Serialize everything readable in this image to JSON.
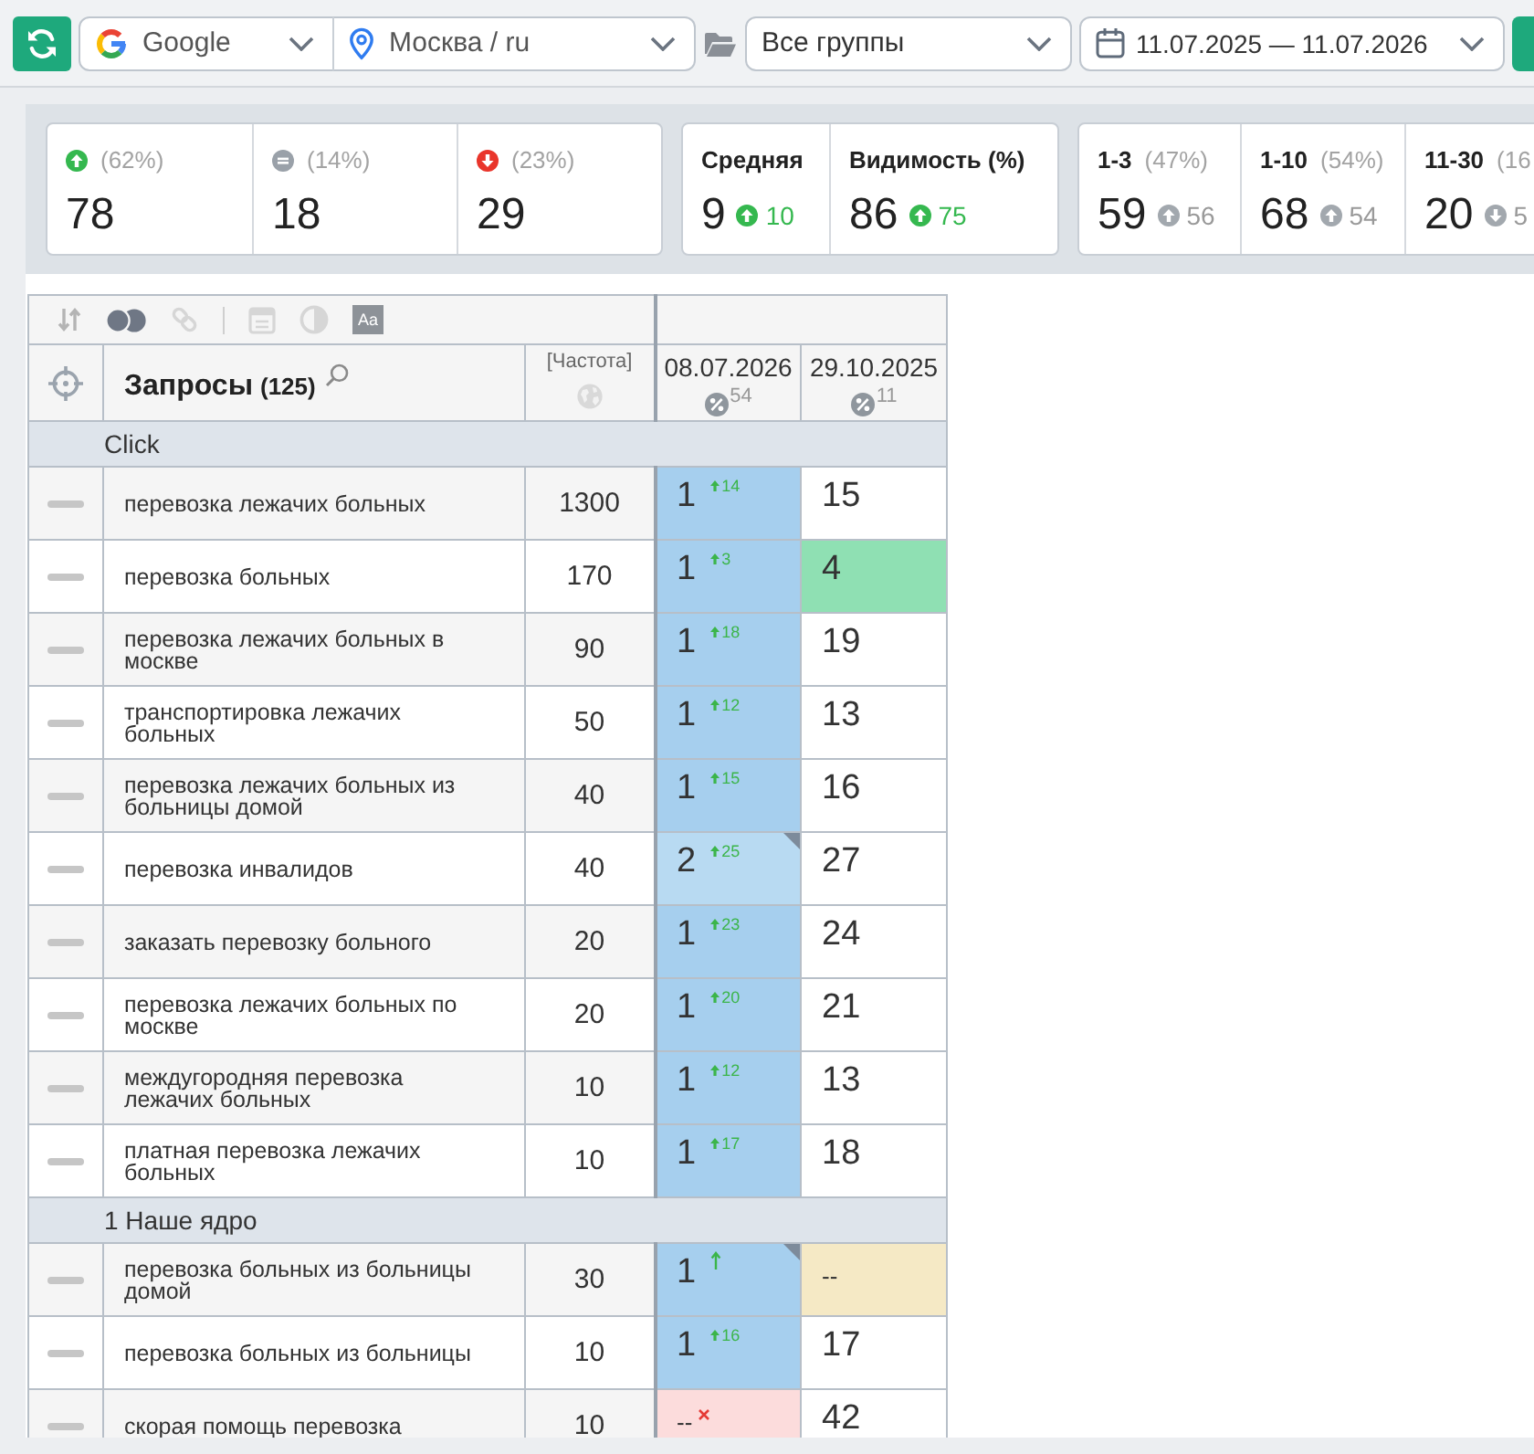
{
  "toolbar": {
    "engine": "Google",
    "region": "Москва / ru",
    "group": "Все группы",
    "period": "11.07.2025 — 11.07.2026"
  },
  "summary": [
    {
      "kind": "up",
      "share": "(62%)",
      "value": "78"
    },
    {
      "kind": "same",
      "share": "(14%)",
      "value": "18"
    },
    {
      "kind": "down",
      "share": "(23%)",
      "value": "29"
    }
  ],
  "averages": [
    {
      "label": "Средняя",
      "value": "9",
      "kind": "up",
      "delta": "10"
    },
    {
      "label": "Видимость (%)",
      "value": "86",
      "kind": "up",
      "delta": "75"
    }
  ],
  "ranges": [
    {
      "label": "1-3",
      "share": "(47%)",
      "value": "59",
      "kind": "up",
      "delta": "56"
    },
    {
      "label": "1-10",
      "share": "(54%)",
      "value": "68",
      "kind": "up",
      "delta": "54"
    },
    {
      "label": "11-30",
      "share": "(16",
      "value": "20",
      "kind": "down",
      "delta": "5"
    }
  ],
  "table": {
    "tools": [
      {
        "kind": "sort",
        "disabled": false
      },
      {
        "kind": "toggle",
        "disabled": false
      },
      {
        "kind": "link",
        "disabled": true
      },
      {
        "kind": "separator"
      },
      {
        "kind": "window",
        "disabled": true
      },
      {
        "kind": "contrast",
        "disabled": true
      },
      {
        "kind": "font",
        "label": "Aa",
        "disabled": false
      }
    ],
    "header": {
      "title": "Запросы",
      "count": "(125)",
      "frequency": "[Частота]",
      "dates": [
        {
          "date": "08.07.2026",
          "share": "54"
        },
        {
          "date": "29.10.2025",
          "share": "11"
        }
      ]
    },
    "groups": [
      {
        "name": "Click",
        "rows": [
          {
            "query": "перевозка лежачих больных",
            "frequency": "1300",
            "positions": [
              {
                "value": "1",
                "color": "#a6cfee",
                "kind": "up",
                "delta": "14",
                "flag": false
              },
              {
                "value": "15",
                "color": "#ffffff",
                "kind": "plain",
                "flag": false
              }
            ]
          },
          {
            "query": "перевозка больных",
            "frequency": "170",
            "positions": [
              {
                "value": "1",
                "color": "#a6cfee",
                "kind": "up",
                "delta": "3",
                "flag": false
              },
              {
                "value": "4",
                "color": "#8fe0b3",
                "kind": "plain",
                "flag": false
              }
            ]
          },
          {
            "query": "перевозка лежачих больных в москве",
            "frequency": "90",
            "positions": [
              {
                "value": "1",
                "color": "#a6cfee",
                "kind": "up",
                "delta": "18",
                "flag": false
              },
              {
                "value": "19",
                "color": "#ffffff",
                "kind": "plain",
                "flag": false
              }
            ]
          },
          {
            "query": "транспортировка лежачих больных",
            "frequency": "50",
            "positions": [
              {
                "value": "1",
                "color": "#a6cfee",
                "kind": "up",
                "delta": "12",
                "flag": false
              },
              {
                "value": "13",
                "color": "#ffffff",
                "kind": "plain",
                "flag": false
              }
            ]
          },
          {
            "query": "перевозка лежачих больных из больницы домой",
            "frequency": "40",
            "positions": [
              {
                "value": "1",
                "color": "#a6cfee",
                "kind": "up",
                "delta": "15",
                "flag": false
              },
              {
                "value": "16",
                "color": "#ffffff",
                "kind": "plain",
                "flag": false
              }
            ]
          },
          {
            "query": "перевозка инвалидов",
            "frequency": "40",
            "positions": [
              {
                "value": "2",
                "color": "#b8daf2",
                "kind": "up",
                "delta": "25",
                "flag": true
              },
              {
                "value": "27",
                "color": "#ffffff",
                "kind": "plain",
                "flag": false
              }
            ]
          },
          {
            "query": "заказать перевозку больного",
            "frequency": "20",
            "positions": [
              {
                "value": "1",
                "color": "#a6cfee",
                "kind": "up",
                "delta": "23",
                "flag": false
              },
              {
                "value": "24",
                "color": "#ffffff",
                "kind": "plain",
                "flag": false
              }
            ]
          },
          {
            "query": "перевозка лежачих больных по москве",
            "frequency": "20",
            "positions": [
              {
                "value": "1",
                "color": "#a6cfee",
                "kind": "up",
                "delta": "20",
                "flag": false
              },
              {
                "value": "21",
                "color": "#ffffff",
                "kind": "plain",
                "flag": false
              }
            ]
          },
          {
            "query": "междугородняя перевозка лежачих больных",
            "frequency": "10",
            "positions": [
              {
                "value": "1",
                "color": "#a6cfee",
                "kind": "up",
                "delta": "12",
                "flag": false
              },
              {
                "value": "13",
                "color": "#ffffff",
                "kind": "plain",
                "flag": false
              }
            ]
          },
          {
            "query": "платная перевозка лежачих больных",
            "frequency": "10",
            "positions": [
              {
                "value": "1",
                "color": "#a6cfee",
                "kind": "up",
                "delta": "17",
                "flag": false
              },
              {
                "value": "18",
                "color": "#ffffff",
                "kind": "plain",
                "flag": false
              }
            ]
          }
        ]
      },
      {
        "name": "1 Наше ядро",
        "rows": [
          {
            "query": "перевозка больных из больницы домой",
            "frequency": "30",
            "positions": [
              {
                "value": "1",
                "color": "#a6cfee",
                "kind": "new",
                "flag": true
              },
              {
                "value": "--",
                "color": "#f5e9c5",
                "kind": "missing",
                "flag": false
              }
            ]
          },
          {
            "query": "перевозка больных из больницы",
            "frequency": "10",
            "positions": [
              {
                "value": "1",
                "color": "#a6cfee",
                "kind": "up",
                "delta": "16",
                "flag": false
              },
              {
                "value": "17",
                "color": "#ffffff",
                "kind": "plain",
                "flag": false
              }
            ]
          },
          {
            "query": "скорая помощь перевозка",
            "frequency": "10",
            "positions": [
              {
                "value": "--",
                "color": "#fcdcdc",
                "kind": "lost",
                "flag": false
              },
              {
                "value": "42",
                "color": "#ffffff",
                "kind": "plain",
                "flag": false
              }
            ]
          }
        ]
      }
    ]
  }
}
